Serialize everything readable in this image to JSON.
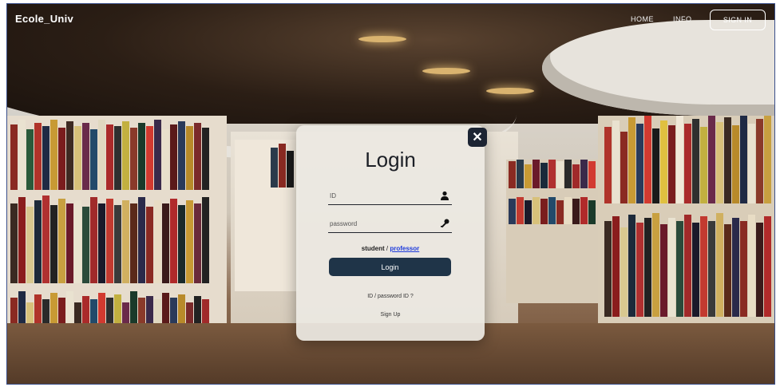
{
  "nav": {
    "brand": "Ecole_Univ",
    "home": "HOME",
    "info": "INFO",
    "signin": "SIGN IN"
  },
  "login": {
    "title": "Login",
    "close": "✕",
    "id_placeholder": "ID",
    "password_placeholder": "password",
    "role_student": "student",
    "role_separator": " / ",
    "role_professor": "professor",
    "submit": "Login",
    "forgot": "ID / password ID ?",
    "signup": "Sign Up"
  },
  "colors": {
    "modal_bg": "#ece8e2",
    "button_bg": "#1f3448",
    "close_bg": "#1c2433",
    "link": "#1d3bdc"
  },
  "icons": {
    "user": "user-icon",
    "key": "key-icon",
    "close": "close-icon"
  }
}
